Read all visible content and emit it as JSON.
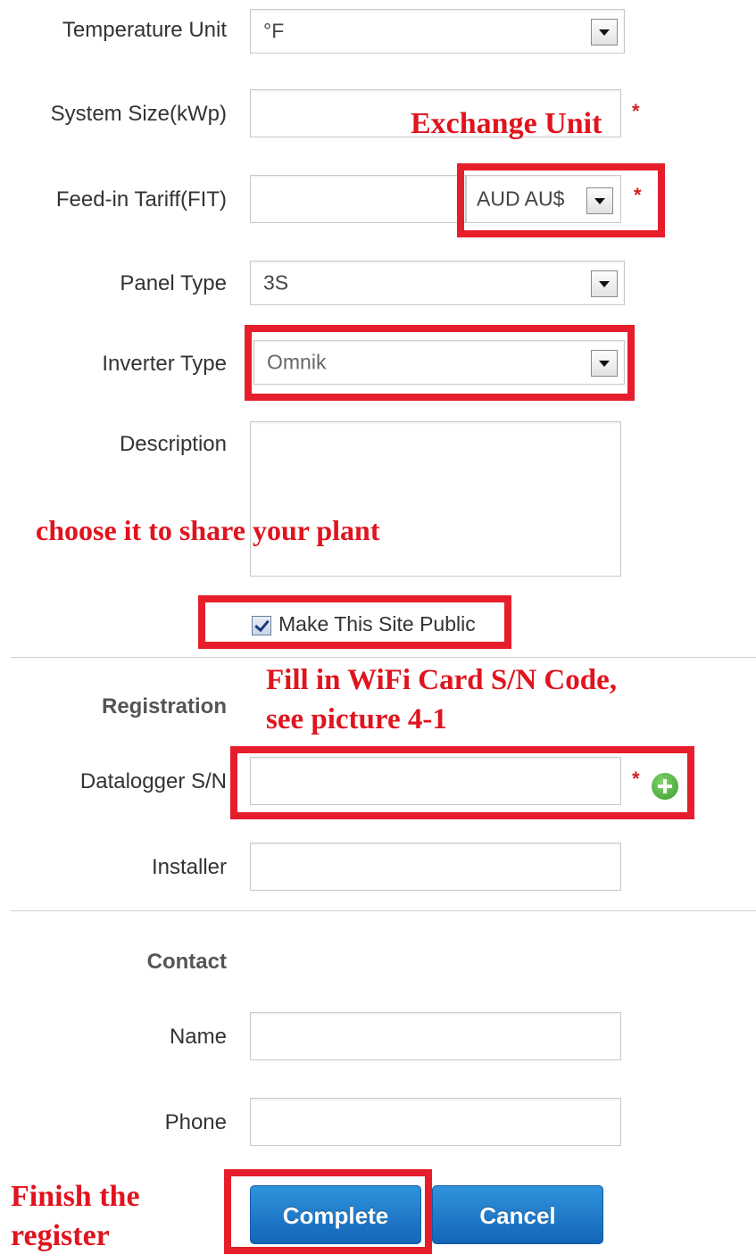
{
  "fields": {
    "temperature_unit": {
      "label": "Temperature Unit",
      "value": "°F"
    },
    "system_size": {
      "label": "System Size(kWp)",
      "value": ""
    },
    "feed_in_tariff": {
      "label": "Feed-in Tariff(FIT)",
      "value": "",
      "currency": "AUD AU$"
    },
    "panel_type": {
      "label": "Panel Type",
      "value": "3S"
    },
    "inverter_type": {
      "label": "Inverter Type",
      "value": "Omnik"
    },
    "description": {
      "label": "Description",
      "value": ""
    },
    "make_public": {
      "label": "Make This Site Public",
      "checked": true
    }
  },
  "registration": {
    "heading": "Registration",
    "datalogger": {
      "label": "Datalogger S/N",
      "value": ""
    },
    "installer": {
      "label": "Installer",
      "value": ""
    }
  },
  "contact": {
    "heading": "Contact",
    "name": {
      "label": "Name",
      "value": ""
    },
    "phone": {
      "label": "Phone",
      "value": ""
    }
  },
  "required_mark": "*",
  "buttons": {
    "complete": "Complete",
    "cancel": "Cancel"
  },
  "annotations": {
    "exchange_unit": "Exchange Unit",
    "share_plant": "choose it to share your plant",
    "wifi_line1": "Fill in WiFi Card S/N Code,",
    "wifi_line2": "see picture 4-1",
    "finish_line1": "Finish the",
    "finish_line2": "register"
  },
  "colors": {
    "annotation_red": "#e0141e",
    "required_red": "#d02020",
    "button_blue": "#1a73c4",
    "add_green": "#3a9d2c"
  },
  "icons": {
    "dropdown": "chevron-down-icon",
    "add": "plus-circle-icon",
    "checkbox": "checkmark-icon"
  }
}
